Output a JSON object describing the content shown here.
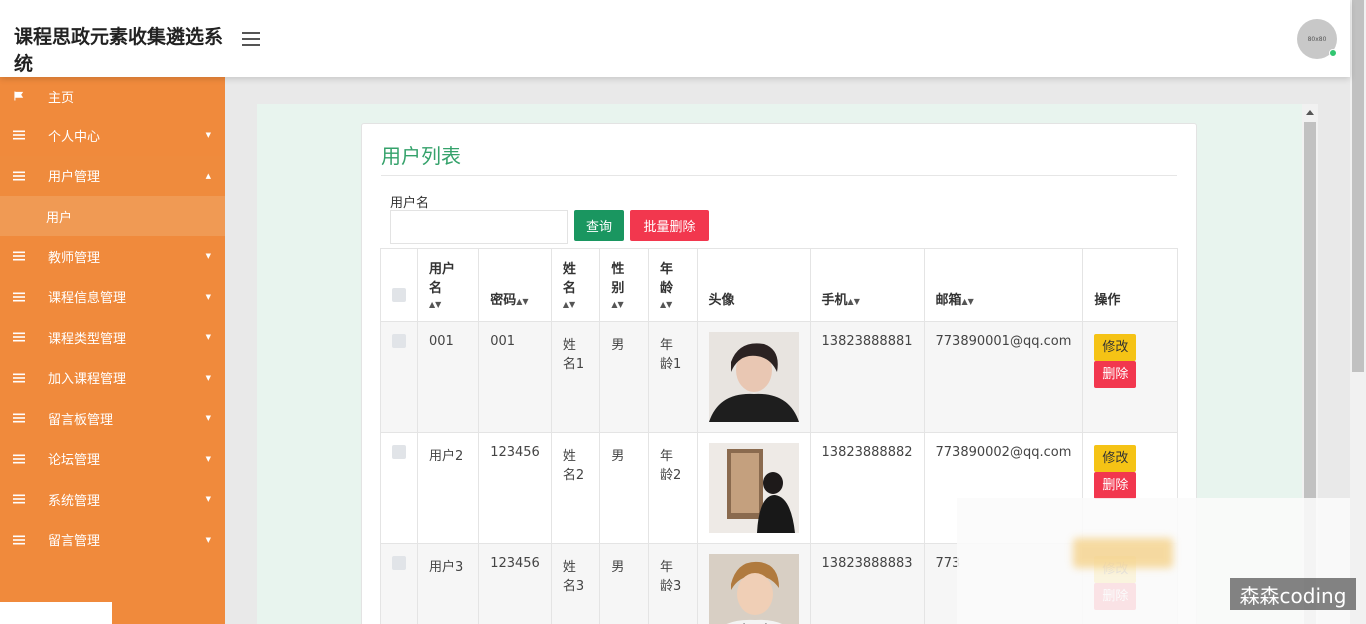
{
  "header": {
    "title": "课程思政元素收集遴选系统",
    "avatar_text": "80x80"
  },
  "sidebar": {
    "items": [
      {
        "label": "主页",
        "icon": "flag-icon"
      },
      {
        "label": "个人中心",
        "icon": "list-icon"
      },
      {
        "label": "用户管理",
        "icon": "list-icon",
        "sub": "用户"
      },
      {
        "label": "教师管理",
        "icon": "list-icon"
      },
      {
        "label": "课程信息管理",
        "icon": "list-icon"
      },
      {
        "label": "课程类型管理",
        "icon": "list-icon"
      },
      {
        "label": "加入课程管理",
        "icon": "list-icon"
      },
      {
        "label": "留言板管理",
        "icon": "list-icon"
      },
      {
        "label": "论坛管理",
        "icon": "list-icon"
      },
      {
        "label": "系统管理",
        "icon": "list-icon"
      },
      {
        "label": "留言管理",
        "icon": "list-icon"
      }
    ]
  },
  "main": {
    "title": "用户列表",
    "search_label": "用户名",
    "search_value": "",
    "query_button": "查询",
    "batch_delete_button": "批量删除",
    "columns": {
      "username": "用户名",
      "password": "密码",
      "name": "姓名",
      "gender": "性别",
      "age": "年龄",
      "avatar": "头像",
      "phone": "手机",
      "email": "邮箱",
      "actions": "操作"
    },
    "edit_label": "修改",
    "delete_label": "删除",
    "rows": [
      {
        "username": "001",
        "password": "001",
        "name": "姓名1",
        "gender": "男",
        "age": "年龄1",
        "phone": "13823888881",
        "email": "773890001@qq.com"
      },
      {
        "username": "用户2",
        "password": "123456",
        "name": "姓名2",
        "gender": "男",
        "age": "年龄2",
        "phone": "13823888882",
        "email": "773890002@qq.com"
      },
      {
        "username": "用户3",
        "password": "123456",
        "name": "姓名3",
        "gender": "男",
        "age": "年龄3",
        "phone": "13823888883",
        "email": "773"
      }
    ]
  },
  "watermark": "森森coding",
  "colors": {
    "sidebar": "#f08a3c",
    "title_green": "#35a26b",
    "query_green": "#1a9660",
    "danger": "#f2374e",
    "warning": "#f5c315"
  }
}
